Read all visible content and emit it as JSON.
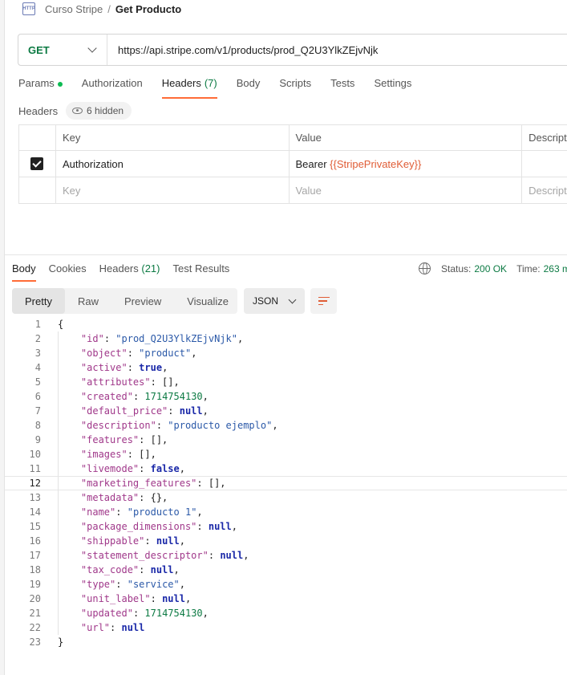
{
  "breadcrumb": {
    "icon_label": "HTTP",
    "parent": "Curso Stripe",
    "separator": "/",
    "current": "Get Producto"
  },
  "request": {
    "method": "GET",
    "url": "https://api.stripe.com/v1/products/prod_Q2U3YlkZEjvNjk"
  },
  "request_tabs": [
    {
      "label": "Params",
      "dot": true
    },
    {
      "label": "Authorization"
    },
    {
      "label": "Headers",
      "count": "(7)",
      "active": true
    },
    {
      "label": "Body"
    },
    {
      "label": "Scripts"
    },
    {
      "label": "Tests"
    },
    {
      "label": "Settings"
    }
  ],
  "headers_section": {
    "label": "Headers",
    "hidden_count": "6 hidden",
    "columns": {
      "key": "Key",
      "value": "Value",
      "description": "Descript"
    },
    "rows": [
      {
        "checked": true,
        "key": "Authorization",
        "value_prefix": "Bearer ",
        "value_var": "{{StripePrivateKey}}"
      }
    ],
    "placeholders": {
      "key": "Key",
      "value": "Value",
      "description": "Descript"
    }
  },
  "response_tabs": [
    {
      "label": "Body",
      "active": true
    },
    {
      "label": "Cookies"
    },
    {
      "label": "Headers",
      "count": "(21)"
    },
    {
      "label": "Test Results"
    }
  ],
  "status": {
    "status_label": "Status:",
    "status_value": "200 OK",
    "time_label": "Time:",
    "time_value": "263 m"
  },
  "view_modes": [
    "Pretty",
    "Raw",
    "Preview",
    "Visualize"
  ],
  "active_view": "Pretty",
  "format": "JSON",
  "code": {
    "highlight_line": 12,
    "lines": [
      [
        [
          "p",
          "{"
        ]
      ],
      [
        [
          "k",
          "\"id\""
        ],
        [
          "p",
          ": "
        ],
        [
          "s",
          "\"prod_Q2U3YlkZEjvNjk\""
        ],
        [
          "p",
          ","
        ]
      ],
      [
        [
          "k",
          "\"object\""
        ],
        [
          "p",
          ": "
        ],
        [
          "s",
          "\"product\""
        ],
        [
          "p",
          ","
        ]
      ],
      [
        [
          "k",
          "\"active\""
        ],
        [
          "p",
          ": "
        ],
        [
          "b",
          "true"
        ],
        [
          "p",
          ","
        ]
      ],
      [
        [
          "k",
          "\"attributes\""
        ],
        [
          "p",
          ": [],"
        ]
      ],
      [
        [
          "k",
          "\"created\""
        ],
        [
          "p",
          ": "
        ],
        [
          "n",
          "1714754130"
        ],
        [
          "p",
          ","
        ]
      ],
      [
        [
          "k",
          "\"default_price\""
        ],
        [
          "p",
          ": "
        ],
        [
          "b",
          "null"
        ],
        [
          "p",
          ","
        ]
      ],
      [
        [
          "k",
          "\"description\""
        ],
        [
          "p",
          ": "
        ],
        [
          "s",
          "\"producto ejemplo\""
        ],
        [
          "p",
          ","
        ]
      ],
      [
        [
          "k",
          "\"features\""
        ],
        [
          "p",
          ": [],"
        ]
      ],
      [
        [
          "k",
          "\"images\""
        ],
        [
          "p",
          ": [],"
        ]
      ],
      [
        [
          "k",
          "\"livemode\""
        ],
        [
          "p",
          ": "
        ],
        [
          "b",
          "false"
        ],
        [
          "p",
          ","
        ]
      ],
      [
        [
          "k",
          "\"marketing_features\""
        ],
        [
          "p",
          ": [],"
        ]
      ],
      [
        [
          "k",
          "\"metadata\""
        ],
        [
          "p",
          ": {},"
        ]
      ],
      [
        [
          "k",
          "\"name\""
        ],
        [
          "p",
          ": "
        ],
        [
          "s",
          "\"producto 1\""
        ],
        [
          "p",
          ","
        ]
      ],
      [
        [
          "k",
          "\"package_dimensions\""
        ],
        [
          "p",
          ": "
        ],
        [
          "b",
          "null"
        ],
        [
          "p",
          ","
        ]
      ],
      [
        [
          "k",
          "\"shippable\""
        ],
        [
          "p",
          ": "
        ],
        [
          "b",
          "null"
        ],
        [
          "p",
          ","
        ]
      ],
      [
        [
          "k",
          "\"statement_descriptor\""
        ],
        [
          "p",
          ": "
        ],
        [
          "b",
          "null"
        ],
        [
          "p",
          ","
        ]
      ],
      [
        [
          "k",
          "\"tax_code\""
        ],
        [
          "p",
          ": "
        ],
        [
          "b",
          "null"
        ],
        [
          "p",
          ","
        ]
      ],
      [
        [
          "k",
          "\"type\""
        ],
        [
          "p",
          ": "
        ],
        [
          "s",
          "\"service\""
        ],
        [
          "p",
          ","
        ]
      ],
      [
        [
          "k",
          "\"unit_label\""
        ],
        [
          "p",
          ": "
        ],
        [
          "b",
          "null"
        ],
        [
          "p",
          ","
        ]
      ],
      [
        [
          "k",
          "\"updated\""
        ],
        [
          "p",
          ": "
        ],
        [
          "n",
          "1714754130"
        ],
        [
          "p",
          ","
        ]
      ],
      [
        [
          "k",
          "\"url\""
        ],
        [
          "p",
          ": "
        ],
        [
          "b",
          "null"
        ]
      ],
      [
        [
          "p",
          "}"
        ]
      ]
    ]
  },
  "colors": {
    "accent": "#ff6c37",
    "method_get": "#0c7a43",
    "json_key": "#a0388a",
    "json_string": "#2b59a8",
    "json_number": "#0c7a43",
    "json_literal": "#1a28a8",
    "variable": "#e05d36"
  }
}
